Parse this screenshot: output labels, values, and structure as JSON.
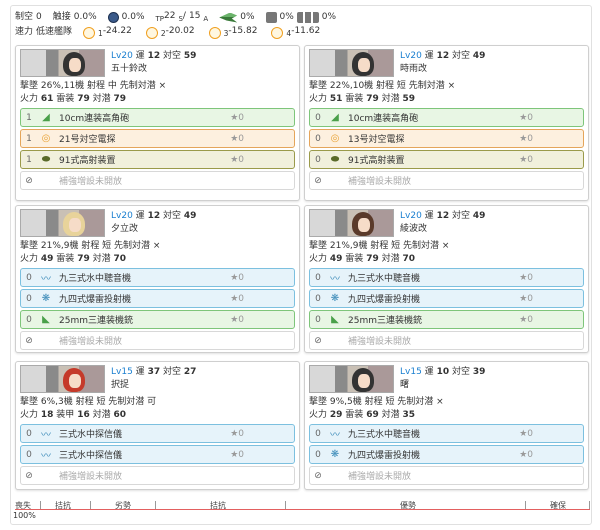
{
  "summary": {
    "air_power_label": "制空",
    "air_power_value": "0",
    "contact_label": "触接",
    "contact_value": "0.0%",
    "radar_value": "0.0%",
    "tp_prefix": "TP",
    "tp_s": "22",
    "tp_s_sub": "S",
    "tp_a": "15",
    "tp_a_sub": "A",
    "tp_sep": "/",
    "plane_pct": "0%",
    "drum1_pct": "0%",
    "drum2_pct": "0%",
    "speed_label": "速力",
    "speed_value": "低速艦隊",
    "exp": [
      {
        "label": "1",
        "value": "-24.22"
      },
      {
        "label": "2",
        "value": "-20.02"
      },
      {
        "label": "3",
        "value": "-15.82"
      },
      {
        "label": "4",
        "value": "-11.62"
      }
    ]
  },
  "ships": [
    {
      "level": "Lv20",
      "luck_label": "運",
      "luck": "12",
      "aa_label": "対空",
      "aa": "59",
      "name": "五十鈴改",
      "line1": "撃墜 26%,11機  射程 中  先制対潜 ×",
      "firepower_label": "火力",
      "firepower": "61",
      "armor_label": "雷装",
      "armor": "79",
      "asw_label": "対潜",
      "asw": "79",
      "slots": [
        {
          "count": "1",
          "icon": "gun-icon",
          "style": "green",
          "name": "10cm連装高角砲",
          "star": "★0"
        },
        {
          "count": "1",
          "icon": "radar-icon",
          "style": "orange",
          "name": "21号対空電探",
          "star": "★0"
        },
        {
          "count": "1",
          "icon": "aa-device-icon",
          "style": "olive",
          "name": "91式高射装置",
          "star": "★0"
        }
      ],
      "ex_slot": "補強増設未開放"
    },
    {
      "level": "Lv20",
      "luck_label": "運",
      "luck": "12",
      "aa_label": "対空",
      "aa": "49",
      "name": "時雨改",
      "line1": "撃墜 22%,10機  射程 短  先制対潜 ×",
      "firepower_label": "火力",
      "firepower": "51",
      "armor_label": "雷装",
      "armor": "79",
      "asw_label": "対潜",
      "asw": "59",
      "slots": [
        {
          "count": "0",
          "icon": "gun-icon",
          "style": "green",
          "name": "10cm連装高角砲",
          "star": "★0"
        },
        {
          "count": "0",
          "icon": "radar-icon",
          "style": "orange",
          "name": "13号対空電探",
          "star": "★0"
        },
        {
          "count": "0",
          "icon": "aa-device-icon",
          "style": "olive",
          "name": "91式高射装置",
          "star": "★0"
        }
      ],
      "ex_slot": "補強増設未開放"
    },
    {
      "level": "Lv20",
      "luck_label": "運",
      "luck": "12",
      "aa_label": "対空",
      "aa": "49",
      "name": "夕立改",
      "line1": "撃墜 21%,9機  射程 短  先制対潜 ×",
      "firepower_label": "火力",
      "firepower": "49",
      "armor_label": "雷装",
      "armor": "79",
      "asw_label": "対潜",
      "asw": "70",
      "slots": [
        {
          "count": "0",
          "icon": "sonar-icon",
          "style": "blue",
          "name": "九三式水中聴音機",
          "star": "★0"
        },
        {
          "count": "0",
          "icon": "depth-charge-icon",
          "style": "blue",
          "name": "九四式爆雷投射機",
          "star": "★0"
        },
        {
          "count": "0",
          "icon": "machine-gun-icon",
          "style": "green",
          "name": "25mm三連装機銃",
          "star": "★0"
        }
      ],
      "ex_slot": "補強増設未開放"
    },
    {
      "level": "Lv20",
      "luck_label": "運",
      "luck": "12",
      "aa_label": "対空",
      "aa": "49",
      "name": "綾波改",
      "line1": "撃墜 21%,9機  射程 短  先制対潜 ×",
      "firepower_label": "火力",
      "firepower": "49",
      "armor_label": "雷装",
      "armor": "79",
      "asw_label": "対潜",
      "asw": "70",
      "slots": [
        {
          "count": "0",
          "icon": "sonar-icon",
          "style": "blue",
          "name": "九三式水中聴音機",
          "star": "★0"
        },
        {
          "count": "0",
          "icon": "depth-charge-icon",
          "style": "blue",
          "name": "九四式爆雷投射機",
          "star": "★0"
        },
        {
          "count": "0",
          "icon": "machine-gun-icon",
          "style": "green",
          "name": "25mm三連装機銃",
          "star": "★0"
        }
      ],
      "ex_slot": "補強増設未開放"
    },
    {
      "level": "Lv15",
      "luck_label": "運",
      "luck": "37",
      "aa_label": "対空",
      "aa": "27",
      "name": "択捉",
      "line1": "撃墜 6%,3機  射程 短  先制対潜 可",
      "firepower_label": "火力",
      "firepower": "18",
      "armor_label": "装甲",
      "armor": "16",
      "asw_label": "対潜",
      "asw": "60",
      "slots": [
        {
          "count": "0",
          "icon": "sonar-icon",
          "style": "blue",
          "name": "三式水中探信儀",
          "star": "★0"
        },
        {
          "count": "0",
          "icon": "sonar-icon",
          "style": "blue",
          "name": "三式水中探信儀",
          "star": "★0"
        }
      ],
      "ex_slot": "補強増設未開放"
    },
    {
      "level": "Lv15",
      "luck_label": "運",
      "luck": "10",
      "aa_label": "対空",
      "aa": "39",
      "name": "曙",
      "line1": "撃墜 9%,5機  射程 短  先制対潜 ×",
      "firepower_label": "火力",
      "firepower": "29",
      "armor_label": "雷装",
      "armor": "69",
      "asw_label": "対潜",
      "asw": "35",
      "slots": [
        {
          "count": "0",
          "icon": "sonar-icon",
          "style": "blue",
          "name": "九三式水中聴音機",
          "star": "★0"
        },
        {
          "count": "0",
          "icon": "depth-charge-icon",
          "style": "blue",
          "name": "九四式爆雷投射機",
          "star": "★0"
        }
      ],
      "ex_slot": "補強増設未開放"
    }
  ],
  "bar": {
    "labels": [
      "喪失",
      "拮抗",
      "劣勢",
      "拮抗",
      "優勢",
      "確保"
    ],
    "percent": "100%"
  }
}
